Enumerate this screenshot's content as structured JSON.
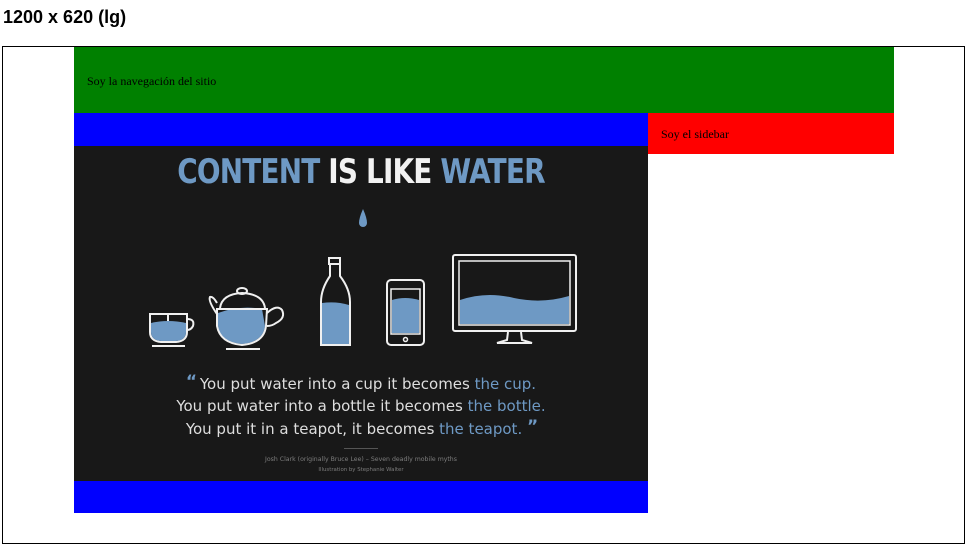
{
  "page": {
    "heading": "1200 x 620 (lg)"
  },
  "nav": {
    "label": "Soy la navegación del sitio"
  },
  "sidebar": {
    "label": "Soy el sidebar"
  },
  "poster": {
    "title": {
      "word1": "CONTENT",
      "word2": "IS LIKE",
      "word3": "WATER"
    },
    "quote": {
      "open_mark": "“",
      "close_mark": "”",
      "line1_text": "You put water into a cup it becomes ",
      "line1_highlight": "the cup.",
      "line2_text": "You put water into a bottle it becomes ",
      "line2_highlight": "the bottle.",
      "line3_text": "You put it in a teapot, it becomes ",
      "line3_highlight": "the teapot."
    },
    "credit_author": "Josh Clark (originally Bruce Lee) – Seven deadly mobile myths",
    "credit_illustration": "Illustration by Stephanie Walter",
    "colors": {
      "background": "#181818",
      "water": "#6e99c4",
      "outline": "#f0f0f0"
    },
    "icons": [
      "water-drop",
      "cup",
      "teapot",
      "bottle",
      "phone",
      "monitor"
    ]
  },
  "colors": {
    "nav": "#008000",
    "main": "#0000ff",
    "sidebar": "#ff0000"
  }
}
